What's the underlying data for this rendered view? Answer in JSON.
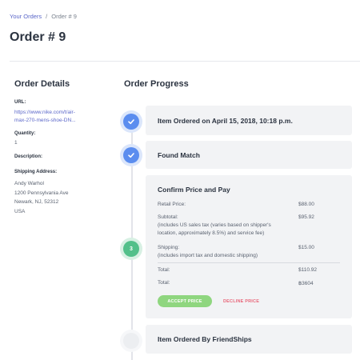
{
  "breadcrumb": {
    "parent": "Your Orders",
    "separator": "/",
    "current": "Order # 9"
  },
  "page_title": "Order # 9",
  "details": {
    "heading": "Order Details",
    "url_label": "URL:",
    "url_line1": "https://www.nike.com/t/air-",
    "url_line2": "max-270-mens-shoe-DN...",
    "quantity_label": "Quantity:",
    "quantity": "1",
    "description_label": "Description:",
    "shipping_label": "Shipping Address:",
    "address": [
      "Andy Warhol",
      "1200 Pennsylvania Ave",
      "Newark, NJ, 52312",
      "USA"
    ]
  },
  "progress": {
    "heading": "Order Progress",
    "step1": "Item Ordered on April 15, 2018, 10:18 p.m.",
    "step2": "Found Match",
    "step3": {
      "number": "3",
      "title": "Confirm Price and Pay",
      "retail_label": "Retail Price:",
      "retail_value": "$88.00",
      "subtotal_label": "Subtotal:",
      "subtotal_note_line1": "(includes US sales tax (varies based on shipper's",
      "subtotal_note_line2": "location, approximately 8.5%) and service fee)",
      "subtotal_value": "$95.92",
      "shipping_label": "Shipping:",
      "shipping_note": "(includes import tax and domestic shipping)",
      "shipping_value": "$15.00",
      "total_label": "Total:",
      "total_value": "$110.92",
      "total2_label": "Total:",
      "total2_value": "฿3604",
      "accept_label": "ACCEPT PRICE",
      "decline_label": "DECLINE PRICE"
    },
    "step4": "Item Ordered By FriendShips"
  },
  "colors": {
    "accent": "#5b67c9",
    "done": "#5b8def",
    "active": "#52c08a",
    "accept": "#8fd67f",
    "decline": "#e8677a"
  },
  "icons": {
    "done": "check-icon"
  }
}
